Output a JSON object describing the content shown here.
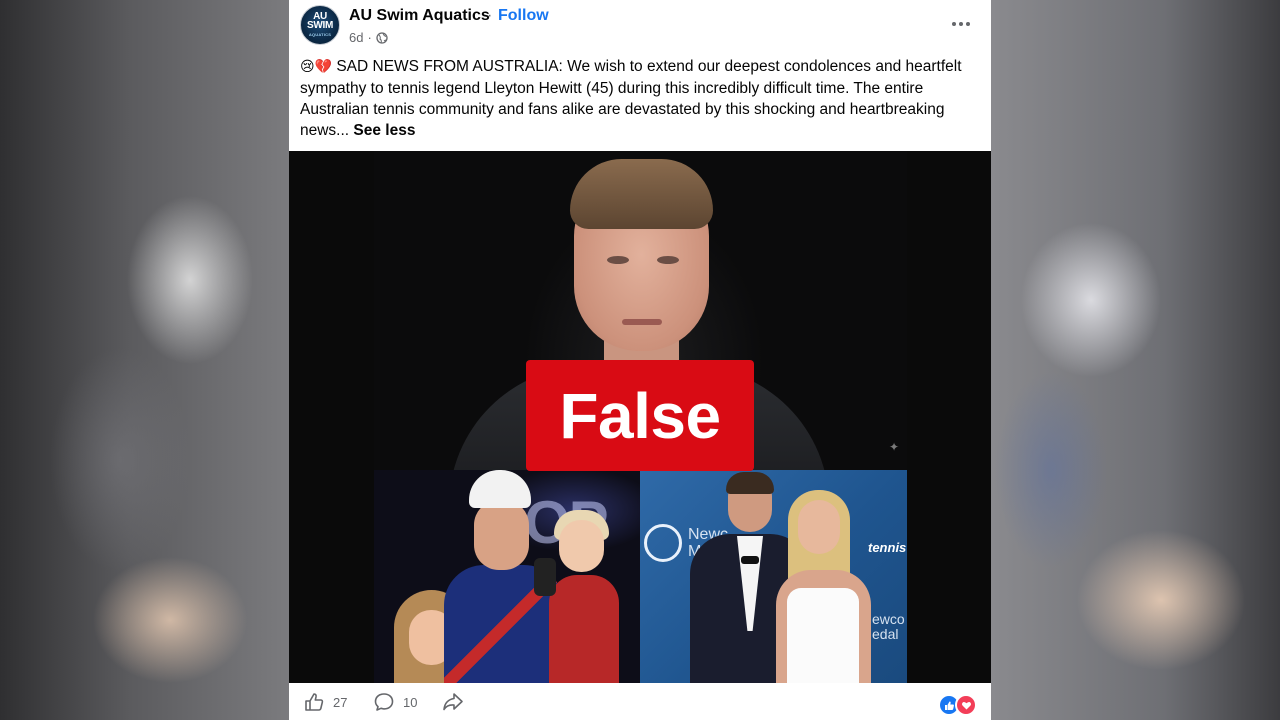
{
  "post": {
    "page_name": "AU Swim Aquatics",
    "separator": "·",
    "follow_label": "Follow",
    "time": "6d",
    "dot": "·",
    "avatar": {
      "line1": "AU SWIM",
      "line2": "AQUATICS"
    },
    "emoji": "😢💔",
    "text": " SAD NEWS FROM AUSTRALIA: We wish to extend our deepest condolences and heartfelt sympathy to tennis legend Lleyton Hewitt (45) during this incredibly difficult time. The entire Australian tennis community and fans alike are devastated by this shocking and heartbreaking news... ",
    "see_less": "See less"
  },
  "media": {
    "badge": "False",
    "bottom_left_bg_text": "OP",
    "bottom_right_bg_text_1": "Newc\nMed",
    "bottom_right_logo": "tennis",
    "bottom_right_bg_text_2": "ewco\nedal"
  },
  "footer": {
    "like_count": "27",
    "comment_count": "10"
  },
  "colors": {
    "accent": "#1877f2",
    "badge": "#d90b14"
  },
  "icons": [
    "globe-icon",
    "more-icon",
    "like-icon",
    "comment-icon",
    "share-icon",
    "like-reaction-icon",
    "love-reaction-icon"
  ]
}
